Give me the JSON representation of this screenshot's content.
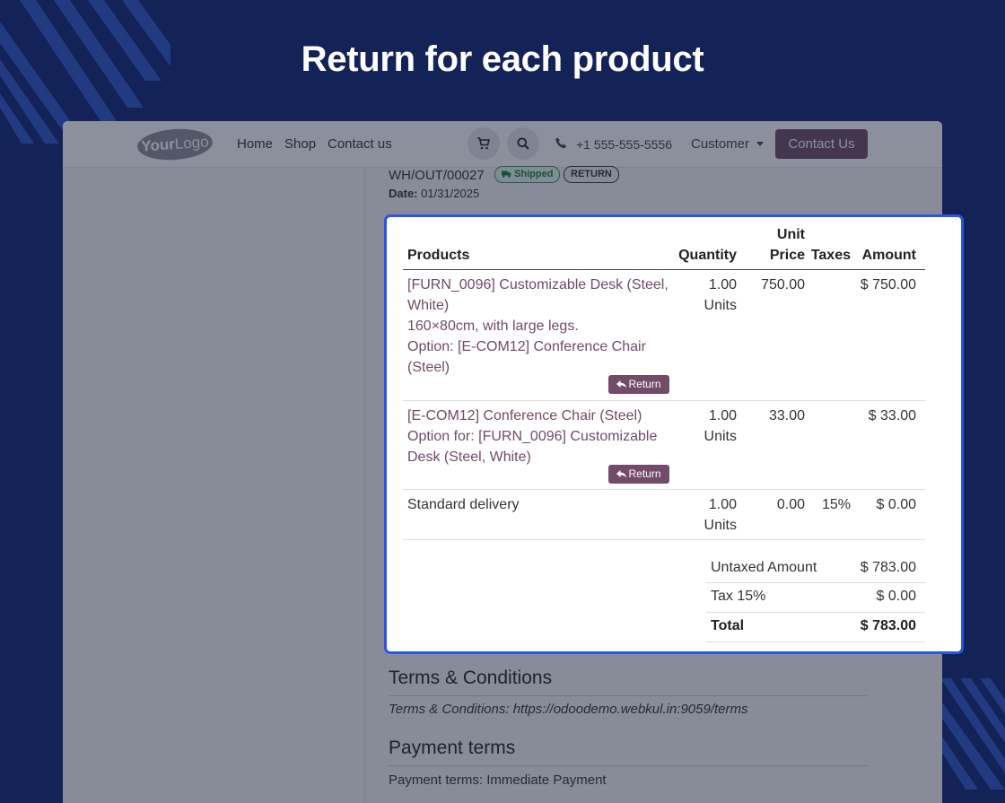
{
  "headline": "Return for each product",
  "navbar": {
    "logo_part1": "Your",
    "logo_part2": "Logo",
    "links": [
      "Home",
      "Shop",
      "Contact us"
    ],
    "phone": "+1 555-555-5556",
    "customer": "Customer",
    "contact_button": "Contact Us"
  },
  "order": {
    "reference": "WH/OUT/00027",
    "shipped_badge": "Shipped",
    "return_badge": "RETURN",
    "date_label": "Date:",
    "date_value": "01/31/2025"
  },
  "table": {
    "headers": {
      "products": "Products",
      "quantity": "Quantity",
      "unit_price_line1": "Unit",
      "unit_price_line2": "Price",
      "taxes": "Taxes",
      "amount": "Amount"
    },
    "rows": [
      {
        "product_lines": [
          "[FURN_0096] Customizable Desk (Steel,",
          "White)",
          "160×80cm, with large legs.",
          "Option: [E-COM12] Conference Chair",
          "(Steel)"
        ],
        "qty": "1.00",
        "unit": "Units",
        "unit_price": "750.00",
        "taxes": "",
        "amount": "$ 750.00",
        "return_label": "Return"
      },
      {
        "product_lines": [
          "[E-COM12] Conference Chair (Steel)",
          "Option for: [FURN_0096] Customizable",
          "Desk (Steel, White)"
        ],
        "qty": "1.00",
        "unit": "Units",
        "unit_price": "33.00",
        "taxes": "",
        "amount": "$ 33.00",
        "return_label": "Return"
      },
      {
        "product_lines": [
          "Standard delivery"
        ],
        "qty": "1.00",
        "unit": "Units",
        "unit_price": "0.00",
        "taxes": "15%",
        "amount": "$ 0.00",
        "return_label": ""
      }
    ]
  },
  "totals": {
    "untaxed_label": "Untaxed Amount",
    "untaxed_value": "$ 783.00",
    "tax_label": "Tax 15%",
    "tax_value": "$ 0.00",
    "total_label": "Total",
    "total_value": "$ 783.00"
  },
  "terms": {
    "heading": "Terms & Conditions",
    "label": "Terms & Conditions:",
    "url": "https://odoodemo.webkul.in:9059/terms"
  },
  "payment": {
    "heading": "Payment terms",
    "text": "Payment terms: Immediate Payment"
  },
  "colors": {
    "background": "#132357",
    "highlight_border": "#2c55e6",
    "brand": "#714b67",
    "shipped": "#2e9b5a"
  }
}
